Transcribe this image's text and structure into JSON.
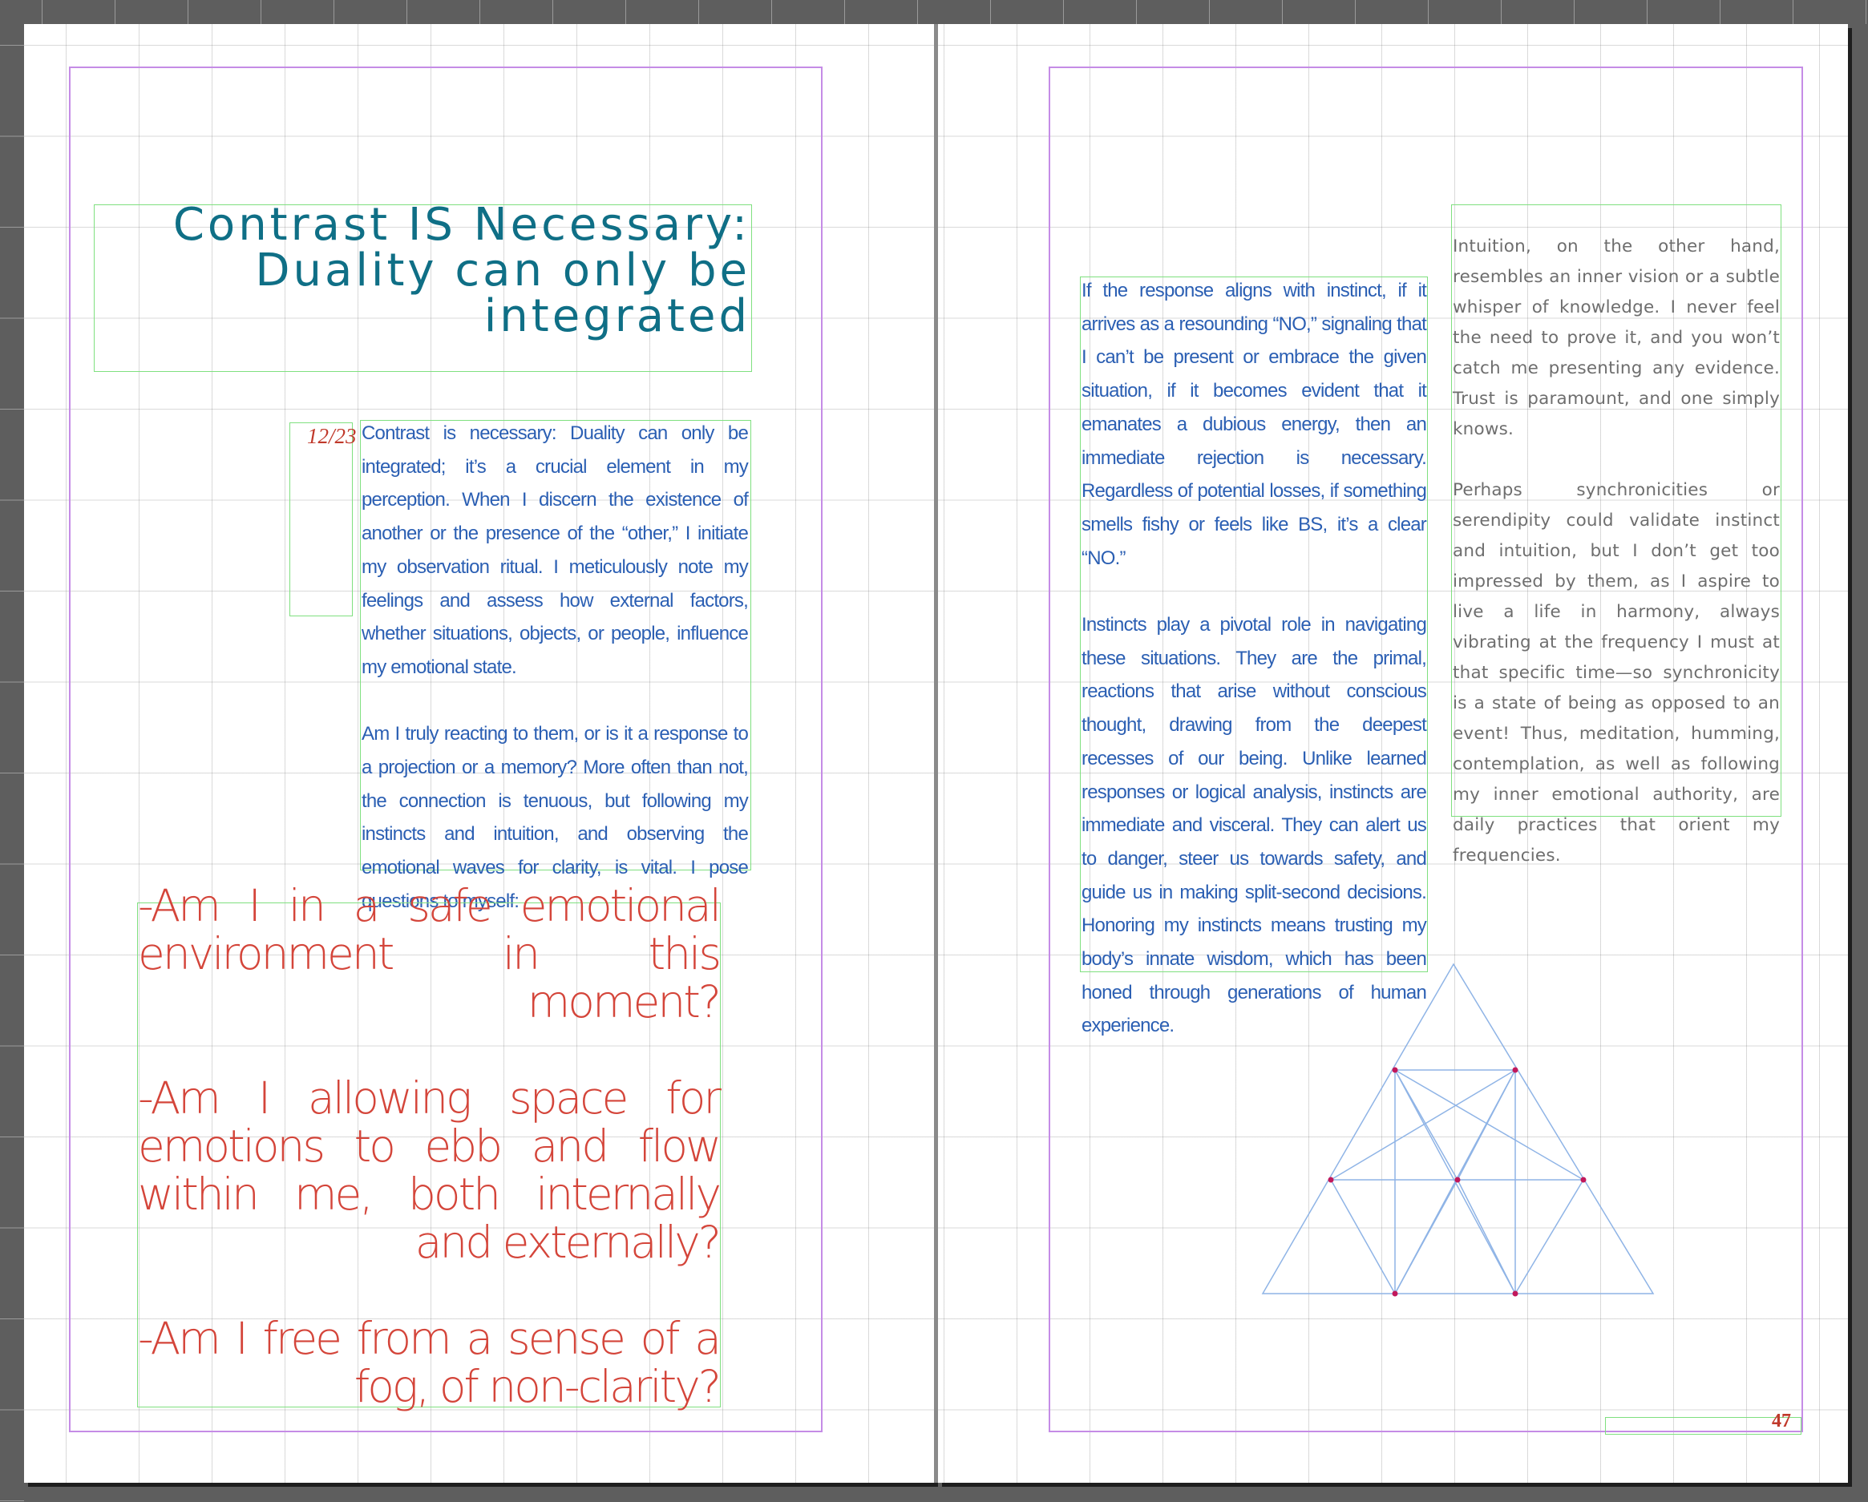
{
  "spread": {
    "left_page": {
      "title": "Contrast IS Necessary: Duality can only be integrated",
      "chapter_marker": "12/23",
      "paragraphs": [
        "Contrast is necessary: Duality can only be integrated; it’s a crucial element in my perception. When I discern the existence of another or the presence of the “other,” I initiate my observation ritual. I meticulously note my feelings and assess how external factors, whether situations, objects, or people, influence my emotional state.",
        "Am I truly reacting to them, or is it a response to a projection or a memory? More often than not, the connection is tenuous, but following my instincts and intuition, and observing the emotional waves for clarity, is vital. I pose questions to myself:"
      ],
      "questions": [
        "-Am I in a safe emotional environment in this moment?",
        "-Am I allowing space for emotions to ebb and flow within me, both internally and externally?",
        "-Am I free from a sense of a fog, of non-clarity?"
      ]
    },
    "right_page": {
      "column_one": [
        "If the response aligns with instinct, if it arrives as a resounding “NO,” signaling that I can’t be present or embrace the given situation, if it becomes evident that it emanates a dubious energy, then an immediate rejection is necessary. Regardless of potential losses, if something smells fishy or feels like BS, it’s a clear “NO.”",
        "Instincts play a pivotal role in navigating these situations. They are the primal, reactions that arise without conscious thought, drawing from the deepest recesses of our being. Unlike learned responses or logical analysis, instincts are immediate and visceral. They can alert us to danger, steer us towards safety, and guide us in making split-second decisions. Honoring my instincts means trusting my body’s innate wisdom, which has been honed through generations of human experience."
      ],
      "column_two": [
        "Intuition, on the other hand, resembles an inner vision or a subtle whisper of knowledge. I never feel the need to prove it, and you won’t catch me presenting any evidence. Trust is paramount, and one simply knows.",
        "Perhaps synchronicities or serendipity could validate instinct and intuition, but I don’t get too impressed by them, as I aspire to live a life in harmony, always vibrating at the frequency I must at that specific time—so synchronicity is a state of being as opposed to an event! Thus, meditation, humming, contemplation, as well as following my inner emotional authority, are daily practices that orient my frequencies."
      ],
      "page_number": "47"
    }
  },
  "colors": {
    "title": "#0f6f86",
    "body_blue": "#2b5fb3",
    "body_gray": "#6e6e6e",
    "questions": "#d4453a",
    "frame": "#7fe07f",
    "margin": "#c58ce6"
  }
}
